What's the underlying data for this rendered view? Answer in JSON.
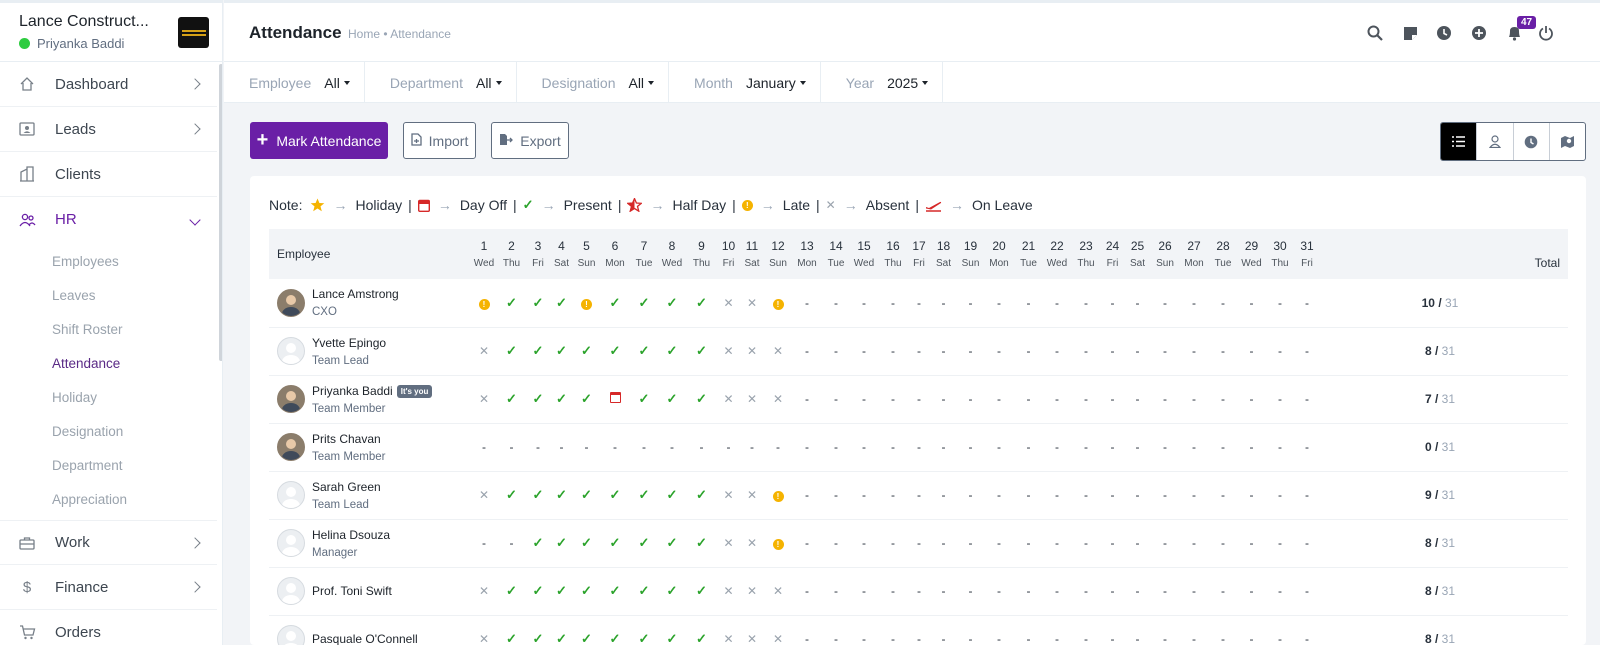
{
  "sidebar": {
    "company": "Lance Construct...",
    "user": "Priyanka Baddi",
    "nav": [
      {
        "label": "Dashboard",
        "icon": "home-icon"
      },
      {
        "label": "Leads",
        "icon": "id-card-icon"
      },
      {
        "label": "Clients",
        "icon": "building-icon"
      },
      {
        "label": "HR",
        "icon": "people-icon"
      },
      {
        "label": "Work",
        "icon": "briefcase-icon"
      },
      {
        "label": "Finance",
        "icon": "dollar-icon"
      },
      {
        "label": "Orders",
        "icon": "cart-icon"
      }
    ],
    "hr_sub": [
      "Employees",
      "Leaves",
      "Shift Roster",
      "Attendance",
      "Holiday",
      "Designation",
      "Department",
      "Appreciation"
    ]
  },
  "header": {
    "title": "Attendance",
    "breadcrumb": "Home • Attendance",
    "notification_count": "47"
  },
  "filters": [
    {
      "label": "Employee",
      "value": "All"
    },
    {
      "label": "Department",
      "value": "All"
    },
    {
      "label": "Designation",
      "value": "All"
    },
    {
      "label": "Month",
      "value": "January"
    },
    {
      "label": "Year",
      "value": "2025"
    }
  ],
  "actions": {
    "mark_attendance": "Mark Attendance",
    "import": "Import",
    "export": "Export"
  },
  "legend": {
    "note": "Note:",
    "items": [
      "Holiday",
      "Day Off",
      "Present",
      "Half Day",
      "Late",
      "Absent",
      "On Leave"
    ]
  },
  "table": {
    "employee_header": "Employee",
    "total_header": "Total",
    "days": [
      {
        "d": "1",
        "w": "Wed"
      },
      {
        "d": "2",
        "w": "Thu"
      },
      {
        "d": "3",
        "w": "Fri"
      },
      {
        "d": "4",
        "w": "Sat"
      },
      {
        "d": "5",
        "w": "Sun"
      },
      {
        "d": "6",
        "w": "Mon"
      },
      {
        "d": "7",
        "w": "Tue"
      },
      {
        "d": "8",
        "w": "Wed"
      },
      {
        "d": "9",
        "w": "Thu"
      },
      {
        "d": "10",
        "w": "Fri"
      },
      {
        "d": "11",
        "w": "Sat"
      },
      {
        "d": "12",
        "w": "Sun"
      },
      {
        "d": "13",
        "w": "Mon"
      },
      {
        "d": "14",
        "w": "Tue"
      },
      {
        "d": "15",
        "w": "Wed"
      },
      {
        "d": "16",
        "w": "Thu"
      },
      {
        "d": "17",
        "w": "Fri"
      },
      {
        "d": "18",
        "w": "Sat"
      },
      {
        "d": "19",
        "w": "Sun"
      },
      {
        "d": "20",
        "w": "Mon"
      },
      {
        "d": "21",
        "w": "Tue"
      },
      {
        "d": "22",
        "w": "Wed"
      },
      {
        "d": "23",
        "w": "Thu"
      },
      {
        "d": "24",
        "w": "Fri"
      },
      {
        "d": "25",
        "w": "Sat"
      },
      {
        "d": "26",
        "w": "Sun"
      },
      {
        "d": "27",
        "w": "Mon"
      },
      {
        "d": "28",
        "w": "Tue"
      },
      {
        "d": "29",
        "w": "Wed"
      },
      {
        "d": "30",
        "w": "Thu"
      },
      {
        "d": "31",
        "w": "Fri"
      }
    ],
    "rows": [
      {
        "name": "Lance Amstrong",
        "role": "CXO",
        "you": false,
        "photo": true,
        "present": "10",
        "total": "31",
        "marks": [
          "L",
          "P",
          "P",
          "P",
          "L",
          "P",
          "P",
          "P",
          "P",
          "A",
          "A",
          "L",
          "-",
          "-",
          "-",
          "-",
          "-",
          "-",
          "-",
          "-",
          "-",
          "-",
          "-",
          "-",
          "-",
          "-",
          "-",
          "-",
          "-",
          "-",
          "-"
        ]
      },
      {
        "name": "Yvette Epingo",
        "role": "Team Lead",
        "you": false,
        "photo": false,
        "present": "8",
        "total": "31",
        "marks": [
          "A",
          "P",
          "P",
          "P",
          "P",
          "P",
          "P",
          "P",
          "P",
          "A",
          "A",
          "A",
          "-",
          "-",
          "-",
          "-",
          "-",
          "-",
          "-",
          "-",
          "-",
          "-",
          "-",
          "-",
          "-",
          "-",
          "-",
          "-",
          "-",
          "-",
          "-"
        ]
      },
      {
        "name": "Priyanka Baddi",
        "role": "Team Member",
        "you": true,
        "photo": true,
        "present": "7",
        "total": "31",
        "marks": [
          "A",
          "P",
          "P",
          "P",
          "P",
          "D",
          "P",
          "P",
          "P",
          "A",
          "A",
          "A",
          "-",
          "-",
          "-",
          "-",
          "-",
          "-",
          "-",
          "-",
          "-",
          "-",
          "-",
          "-",
          "-",
          "-",
          "-",
          "-",
          "-",
          "-",
          "-"
        ]
      },
      {
        "name": "Prits Chavan",
        "role": "Team Member",
        "you": false,
        "photo": true,
        "present": "0",
        "total": "31",
        "marks": [
          "-",
          "-",
          "-",
          "-",
          "-",
          "-",
          "-",
          "-",
          "-",
          "-",
          "-",
          "-",
          "-",
          "-",
          "-",
          "-",
          "-",
          "-",
          "-",
          "-",
          "-",
          "-",
          "-",
          "-",
          "-",
          "-",
          "-",
          "-",
          "-",
          "-",
          "-"
        ]
      },
      {
        "name": "Sarah Green",
        "role": "Team Lead",
        "you": false,
        "photo": false,
        "present": "9",
        "total": "31",
        "marks": [
          "A",
          "P",
          "P",
          "P",
          "P",
          "P",
          "P",
          "P",
          "P",
          "A",
          "A",
          "L",
          "-",
          "-",
          "-",
          "-",
          "-",
          "-",
          "-",
          "-",
          "-",
          "-",
          "-",
          "-",
          "-",
          "-",
          "-",
          "-",
          "-",
          "-",
          "-"
        ]
      },
      {
        "name": "Helina Dsouza",
        "role": "Manager",
        "you": false,
        "photo": false,
        "present": "8",
        "total": "31",
        "marks": [
          "-",
          "-",
          "P",
          "P",
          "P",
          "P",
          "P",
          "P",
          "P",
          "A",
          "A",
          "L",
          "-",
          "-",
          "-",
          "-",
          "-",
          "-",
          "-",
          "-",
          "-",
          "-",
          "-",
          "-",
          "-",
          "-",
          "-",
          "-",
          "-",
          "-",
          "-"
        ]
      },
      {
        "name": "Prof. Toni Swift",
        "role": "",
        "you": false,
        "photo": false,
        "present": "8",
        "total": "31",
        "marks": [
          "A",
          "P",
          "P",
          "P",
          "P",
          "P",
          "P",
          "P",
          "P",
          "A",
          "A",
          "A",
          "-",
          "-",
          "-",
          "-",
          "-",
          "-",
          "-",
          "-",
          "-",
          "-",
          "-",
          "-",
          "-",
          "-",
          "-",
          "-",
          "-",
          "-",
          "-"
        ]
      },
      {
        "name": "Pasquale O'Connell",
        "role": "",
        "you": false,
        "photo": false,
        "present": "8",
        "total": "31",
        "marks": [
          "A",
          "P",
          "P",
          "P",
          "P",
          "P",
          "P",
          "P",
          "P",
          "A",
          "A",
          "A",
          "-",
          "-",
          "-",
          "-",
          "-",
          "-",
          "-",
          "-",
          "-",
          "-",
          "-",
          "-",
          "-",
          "-",
          "-",
          "-",
          "-",
          "-",
          "-"
        ]
      }
    ],
    "you_badge": "It's you"
  },
  "colors": {
    "brand": "#6a1fa6",
    "present": "#2ba32b",
    "late": "#f5b300",
    "day_off": "#d62828"
  }
}
